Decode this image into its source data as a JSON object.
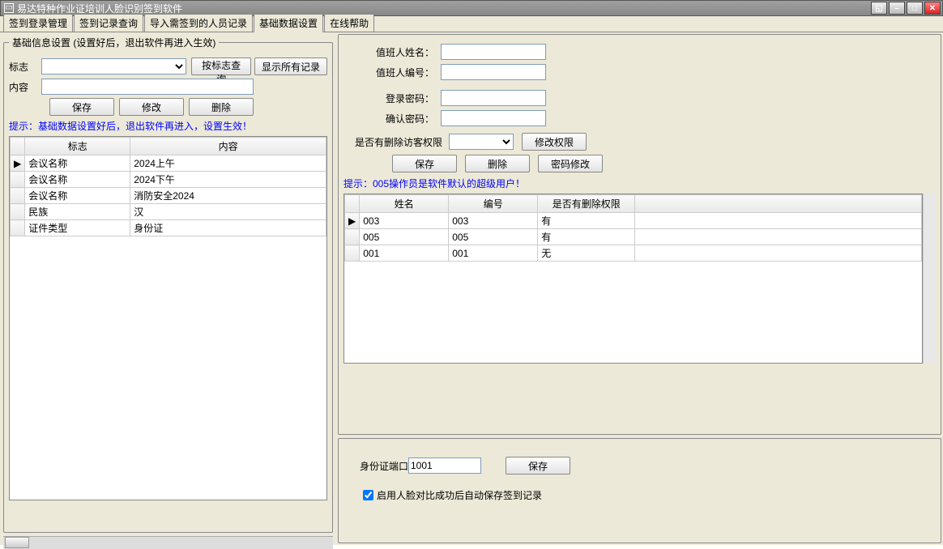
{
  "window": {
    "title": "易达特种作业证培训人脸识别签到软件"
  },
  "tabs": {
    "items": [
      {
        "label": "签到登录管理"
      },
      {
        "label": "签到记录查询"
      },
      {
        "label": "导入需签到的人员记录"
      },
      {
        "label": "基础数据设置",
        "active": true
      },
      {
        "label": "在线帮助"
      }
    ]
  },
  "left": {
    "group_title": "基础信息设置 (设置好后，退出软件再进入生效)",
    "label_flag": "标志",
    "label_content": "内容",
    "btn_query": "按标志查询",
    "btn_showall": "显示所有记录",
    "btn_save": "保存",
    "btn_modify": "修改",
    "btn_delete": "删除",
    "hint": "提示：基础数据设置好后，退出软件再进入，设置生效！",
    "grid": {
      "headers": [
        "标志",
        "内容"
      ],
      "rows": [
        {
          "flag": "会议名称",
          "content": "2024上午"
        },
        {
          "flag": "会议名称",
          "content": "2024下午"
        },
        {
          "flag": "会议名称",
          "content": "消防安全2024"
        },
        {
          "flag": "民族",
          "content": "汉"
        },
        {
          "flag": "证件类型",
          "content": "身份证"
        }
      ]
    }
  },
  "right_top": {
    "label_name": "值班人姓名：",
    "label_no": "值班人编号：",
    "label_pwd": "登录密码：",
    "label_confirm": "确认密码：",
    "label_perm": "是否有删除访客权限",
    "btn_modperm": "修改权限",
    "btn_save": "保存",
    "btn_delete": "删除",
    "btn_pwdmod": "密码修改",
    "hint": "提示：005操作员是软件默认的超级用户！",
    "grid": {
      "headers": [
        "姓名",
        "编号",
        "是否有删除权限"
      ],
      "rows": [
        {
          "name": "003",
          "no": "003",
          "perm": "有"
        },
        {
          "name": "005",
          "no": "005",
          "perm": "有"
        },
        {
          "name": "001",
          "no": "001",
          "perm": "无"
        }
      ]
    }
  },
  "right_bottom": {
    "label_port": "身份证端口",
    "port_value": "1001",
    "btn_save": "保存",
    "checkbox_label": "启用人脸对比成功后自动保存签到记录",
    "checked": true
  }
}
